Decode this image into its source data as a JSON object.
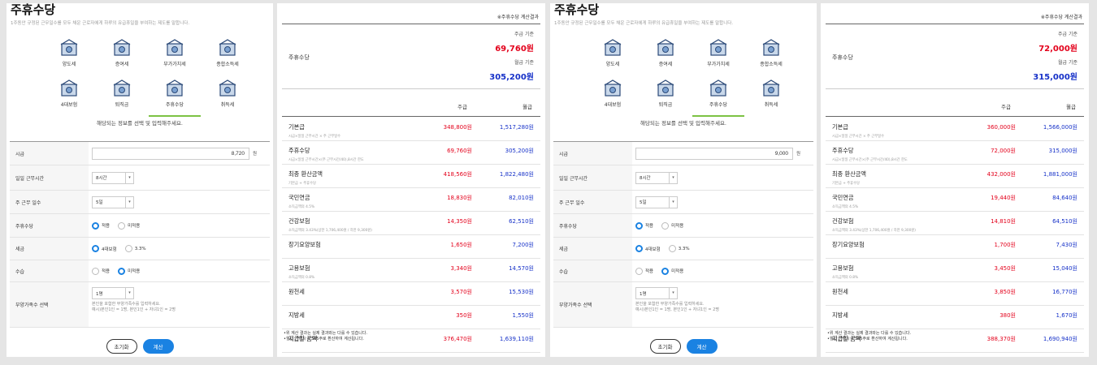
{
  "screens": [
    {
      "title": "주휴수당",
      "subtitle": "1주동안 규정된 근무일수를 모두 채운 근로자에게 하루의 유급휴일을 부여하는 제도를 말합니다.",
      "tiles": [
        {
          "label": "양도세",
          "icon": "house-tax-icon"
        },
        {
          "label": "증여세",
          "icon": "gift-people-icon"
        },
        {
          "label": "부가가치세",
          "icon": "vat-icon"
        },
        {
          "label": "종합소득세",
          "icon": "building-icon"
        },
        {
          "label": "4대보험",
          "icon": "group-icon"
        },
        {
          "label": "퇴직금",
          "icon": "hand-coin-icon"
        },
        {
          "label": "주휴수당",
          "icon": "wallet-icon"
        },
        {
          "label": "취득세",
          "icon": "document-icon"
        }
      ],
      "guide": "해당되는 정보를 선택 및 입력해주세요.",
      "fields": {
        "wage_label": "시급",
        "wage_value": "8,720",
        "wage_unit": "원",
        "hours_label": "일일 근무시간",
        "hours_value": "8시간",
        "days_label": "주 근무 일수",
        "days_value": "5일",
        "allow_label": "주휴수당",
        "allow_opts": [
          "적용",
          "미적용"
        ],
        "tax_label": "세금",
        "tax_opts": [
          "4대보험",
          "3.3%"
        ],
        "intern_label": "수습",
        "intern_opts": [
          "적용",
          "미적용"
        ],
        "dep_label": "부양가족수 선택",
        "dep_value": "1명",
        "dep_note": "본인을 포함한 부양가족수를 입력하세요.",
        "dep_ex": "예시)본인1인 = 1명, 본인1인 + 자녀1인 = 2명"
      },
      "buttons": {
        "reset": "초기화",
        "calc": "계산"
      }
    },
    {
      "title": "주휴수당",
      "subtitle": "1주동안 규정된 근무일수를 모두 채운 근로자에게 하루의 유급휴일을 부여하는 제도를 말합니다.",
      "tiles": [
        {
          "label": "양도세",
          "icon": "house-tax-icon"
        },
        {
          "label": "증여세",
          "icon": "gift-people-icon"
        },
        {
          "label": "부가가치세",
          "icon": "vat-icon"
        },
        {
          "label": "종합소득세",
          "icon": "building-icon"
        },
        {
          "label": "4대보험",
          "icon": "group-icon"
        },
        {
          "label": "퇴직금",
          "icon": "hand-coin-icon"
        },
        {
          "label": "주휴수당",
          "icon": "wallet-icon"
        },
        {
          "label": "취득세",
          "icon": "document-icon"
        }
      ],
      "guide": "해당되는 정보를 선택 및 입력해주세요.",
      "fields": {
        "wage_label": "시급",
        "wage_value": "9,000",
        "wage_unit": "원",
        "hours_label": "일일 근무시간",
        "hours_value": "8시간",
        "days_label": "주 근무 일수",
        "days_value": "5일",
        "allow_label": "주휴수당",
        "allow_opts": [
          "적용",
          "미적용"
        ],
        "tax_label": "세금",
        "tax_opts": [
          "4대보험",
          "3.3%"
        ],
        "intern_label": "수습",
        "intern_opts": [
          "적용",
          "미적용"
        ],
        "dep_label": "부양가족수 선택",
        "dep_value": "1명",
        "dep_note": "본인을 포함한 부양가족수를 입력하세요.",
        "dep_ex": "예시)본인1인 = 1명, 본인1인 + 자녀1인 = 2명"
      },
      "buttons": {
        "reset": "초기화",
        "calc": "계산"
      }
    }
  ],
  "results": [
    {
      "header": "※주휴수당 계산결과",
      "label": "주휴수당",
      "weekly_key": "주급 기준",
      "weekly_val": "69,760원",
      "monthly_key": "월급 기준",
      "monthly_val": "305,200원",
      "col_week": "주급",
      "col_month": "월급",
      "rows": [
        {
          "n": "기본급",
          "d": "시급×일일 근무시간 × 주 근무일수",
          "w": "348,800원",
          "m": "1,517,280원"
        },
        {
          "n": "주휴수당",
          "d": "시급×일일 근무시간×(주 근무시간/40),8시간 한도",
          "w": "69,760원",
          "m": "305,200원"
        },
        {
          "n": "최종 환산금액",
          "d": "기본급 + 주휴수당",
          "w": "418,560원",
          "m": "1,822,480원"
        },
        {
          "n": "국민연금",
          "d": "소득금액의 4.5%",
          "w": "18,830원",
          "m": "82,010원"
        },
        {
          "n": "건강보험",
          "d": "소득금액의 3.43%(상한 1,706,400원 / 하한 9,300원)",
          "w": "14,350원",
          "m": "62,510원"
        },
        {
          "n": "장기요양보험",
          "d": "",
          "w": "1,650원",
          "m": "7,200원"
        },
        {
          "n": "고용보험",
          "d": "소득금액의 0.8%",
          "w": "3,340원",
          "m": "14,570원"
        },
        {
          "n": "원천세",
          "d": "",
          "w": "3,570원",
          "m": "15,530원"
        },
        {
          "n": "지방세",
          "d": "",
          "w": "350원",
          "m": "1,550원"
        },
        {
          "n": "지급할 금액",
          "d": "",
          "w": "376,470원",
          "m": "1,639,110원"
        }
      ],
      "foot1": "•위 계산 결과는 실제 결과와는 다를 수 있습니다.",
      "foot2": "•월급 산택시 4.345주로 환산하여 계산됩니다."
    },
    {
      "header": "※주휴수당 계산결과",
      "label": "주휴수당",
      "weekly_key": "주급 기준",
      "weekly_val": "72,000원",
      "monthly_key": "월급 기준",
      "monthly_val": "315,000원",
      "col_week": "주급",
      "col_month": "월급",
      "rows": [
        {
          "n": "기본급",
          "d": "시급×일일 근무시간 × 주 근무일수",
          "w": "360,000원",
          "m": "1,566,000원"
        },
        {
          "n": "주휴수당",
          "d": "시급×일일 근무시간×(주 근무시간/40),8시간 한도",
          "w": "72,000원",
          "m": "315,000원"
        },
        {
          "n": "최종 환산금액",
          "d": "기본급 + 주휴수당",
          "w": "432,000원",
          "m": "1,881,000원"
        },
        {
          "n": "국민연금",
          "d": "소득금액의 4.5%",
          "w": "19,440원",
          "m": "84,640원"
        },
        {
          "n": "건강보험",
          "d": "소득금액의 3.43%(상한 1,706,400원 / 하한 9,300원)",
          "w": "14,810원",
          "m": "64,510원"
        },
        {
          "n": "장기요양보험",
          "d": "",
          "w": "1,700원",
          "m": "7,430원"
        },
        {
          "n": "고용보험",
          "d": "소득금액의 0.8%",
          "w": "3,450원",
          "m": "15,040원"
        },
        {
          "n": "원천세",
          "d": "",
          "w": "3,850원",
          "m": "16,770원"
        },
        {
          "n": "지방세",
          "d": "",
          "w": "380원",
          "m": "1,670원"
        },
        {
          "n": "지급할 금액",
          "d": "",
          "w": "388,370원",
          "m": "1,690,940원"
        }
      ],
      "foot1": "•위 계산 결과는 실제 결과와는 다를 수 있습니다.",
      "foot2": "•월급 선택시 4.345주로 환산하여 계산됩니다."
    }
  ],
  "colors": {
    "accent": "#1a82e2",
    "red": "#e3001b",
    "blue": "#1530c8",
    "tab_underline": "#7cc243"
  }
}
